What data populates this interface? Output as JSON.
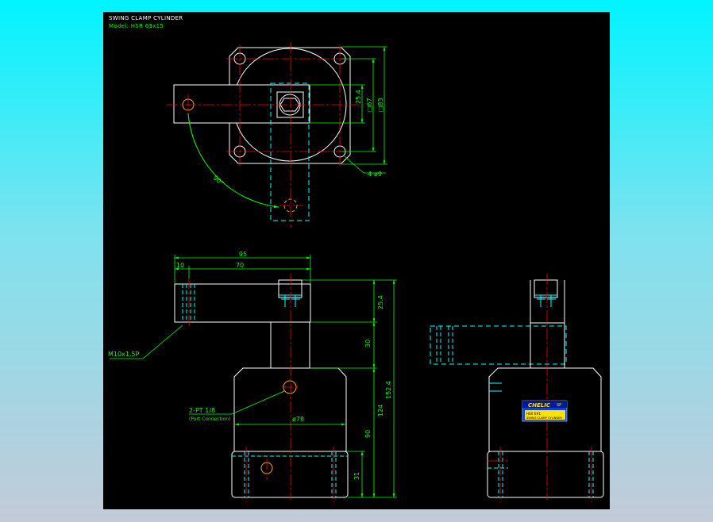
{
  "header": {
    "title": "SWING CLAMP CYLINDER",
    "model": "Model: HSR 63x15"
  },
  "dims": {
    "plate_d1": "25.4",
    "plate_d2": "□67",
    "plate_d3": "□83",
    "holes": "4-ø9",
    "angle": "90°",
    "overall_w": "95",
    "w10": "10",
    "w70": "70",
    "h25": "25.4",
    "h30": "30",
    "h152": "152.4",
    "h124": "124",
    "h90": "90",
    "h31": "31",
    "dia78": "ø78"
  },
  "callouts": {
    "thread": "M10x1.5P",
    "port": "2-PT 1/8",
    "port_sub": "(Port Connection)"
  },
  "nameplate": {
    "brand": "CHELIC",
    "suffix": "SP",
    "line1": "HSR 6#1",
    "line2": "SWING CLAMP CYLINDER"
  },
  "colors": {
    "background": "#000000",
    "outline": "#ffffff",
    "centerline": "#ff0000",
    "hidden": "#00ffff",
    "dimension": "#00ff00",
    "hole": "#ffa500"
  }
}
